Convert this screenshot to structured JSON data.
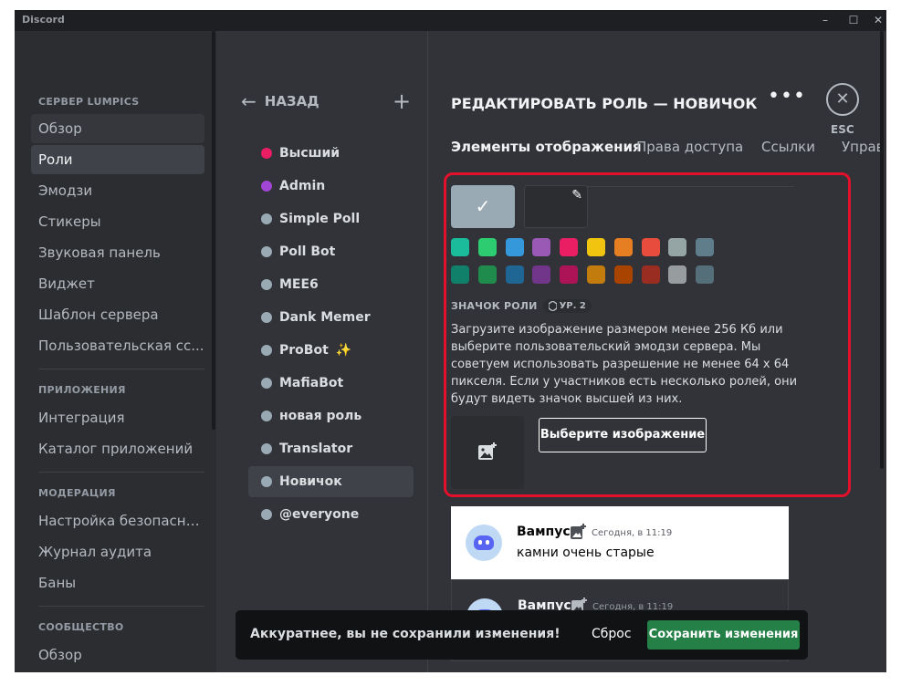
{
  "window": {
    "title": "Discord",
    "controls": [
      "–",
      "☐",
      "✕"
    ]
  },
  "sidebar": {
    "sections": [
      {
        "header": "СЕРВЕР LUMPICS",
        "items": [
          "Обзор",
          "Роли",
          "Эмодзи",
          "Стикеры",
          "Звуковая панель",
          "Виджет",
          "Шаблон сервера",
          "Пользовательская сс..."
        ]
      },
      {
        "header": "ПРИЛОЖЕНИЯ",
        "items": [
          "Интеграция",
          "Каталог приложений"
        ]
      },
      {
        "header": "МОДЕРАЦИЯ",
        "items": [
          "Настройка безопасно...",
          "Журнал аудита",
          "Баны"
        ]
      },
      {
        "header": "СООБЩЕСТВО",
        "items": [
          "Обзор"
        ]
      }
    ],
    "active_item": "Роли"
  },
  "roles_panel": {
    "back_label": "НАЗАД",
    "add_icon": "plus-icon",
    "roles": [
      {
        "name": "Высший",
        "color": "#e91e63"
      },
      {
        "name": "Admin",
        "color": "#a246d6"
      },
      {
        "name": "Simple Poll",
        "color": "#99aab5"
      },
      {
        "name": "Poll Bot",
        "color": "#99aab5"
      },
      {
        "name": "MEE6",
        "color": "#99aab5"
      },
      {
        "name": "Dank Memer",
        "color": "#99aab5"
      },
      {
        "name": "ProBot",
        "color": "#99aab5",
        "suffix": "✨"
      },
      {
        "name": "MafiaBot",
        "color": "#99aab5"
      },
      {
        "name": "новая роль",
        "color": "#99aab5"
      },
      {
        "name": "Translator",
        "color": "#99aab5"
      },
      {
        "name": "Новичок",
        "color": "#99aab5"
      },
      {
        "name": "@everyone",
        "color": "#99aab5"
      }
    ],
    "active_role": "Новичок"
  },
  "main": {
    "title": "РЕДАКТИРОВАТЬ РОЛЬ — НОВИЧОК",
    "more_label": "•••",
    "close_icon": "close-icon",
    "close_label": "✕",
    "esc_label": "ESC",
    "tabs": [
      "Элементы отображения",
      "Права доступа",
      "Ссылки",
      "Управ"
    ],
    "active_tab": "Элементы отображения",
    "default_color": "#99aab5",
    "swatches_row1": [
      "#1abc9c",
      "#2ecc71",
      "#3498db",
      "#9b59b6",
      "#e91e63",
      "#f1c40f",
      "#e67e22",
      "#e74c3c",
      "#95a5a6",
      "#607d8b"
    ],
    "swatches_row2": [
      "#11806a",
      "#1f8b4c",
      "#206694",
      "#71368a",
      "#ad1457",
      "#c27c0e",
      "#a84300",
      "#992d22",
      "#979c9f",
      "#546e7a"
    ],
    "role_icon": {
      "header": "ЗНАЧОК РОЛИ",
      "boost_label": "УР. 2",
      "description": "Загрузите изображение размером менее 256 Кб или выберите пользовательский эмодзи сервера. Мы советуем использовать разрешение не менее 64 x 64 пикселя. Если у участников есть несколько ролей, они будут видеть значок высшей из них.",
      "choose_button": "Выберите изображение"
    },
    "preview": [
      {
        "theme": "light",
        "username": "Вампус",
        "time": "Сегодня, в 11:19",
        "message": "камни очень старые"
      },
      {
        "theme": "dark",
        "username": "Вампус",
        "time": "Сегодня, в 11:19",
        "message": ""
      }
    ]
  },
  "unsaved_bar": {
    "message": "Аккуратнее, вы не сохранили изменения!",
    "reset_label": "Сброс",
    "save_label": "Сохранить изменения",
    "save_color": "#248046"
  },
  "colors": {
    "highlight_border": "#e3102c",
    "background": "#313338",
    "sidebar": "#2b2d31"
  }
}
